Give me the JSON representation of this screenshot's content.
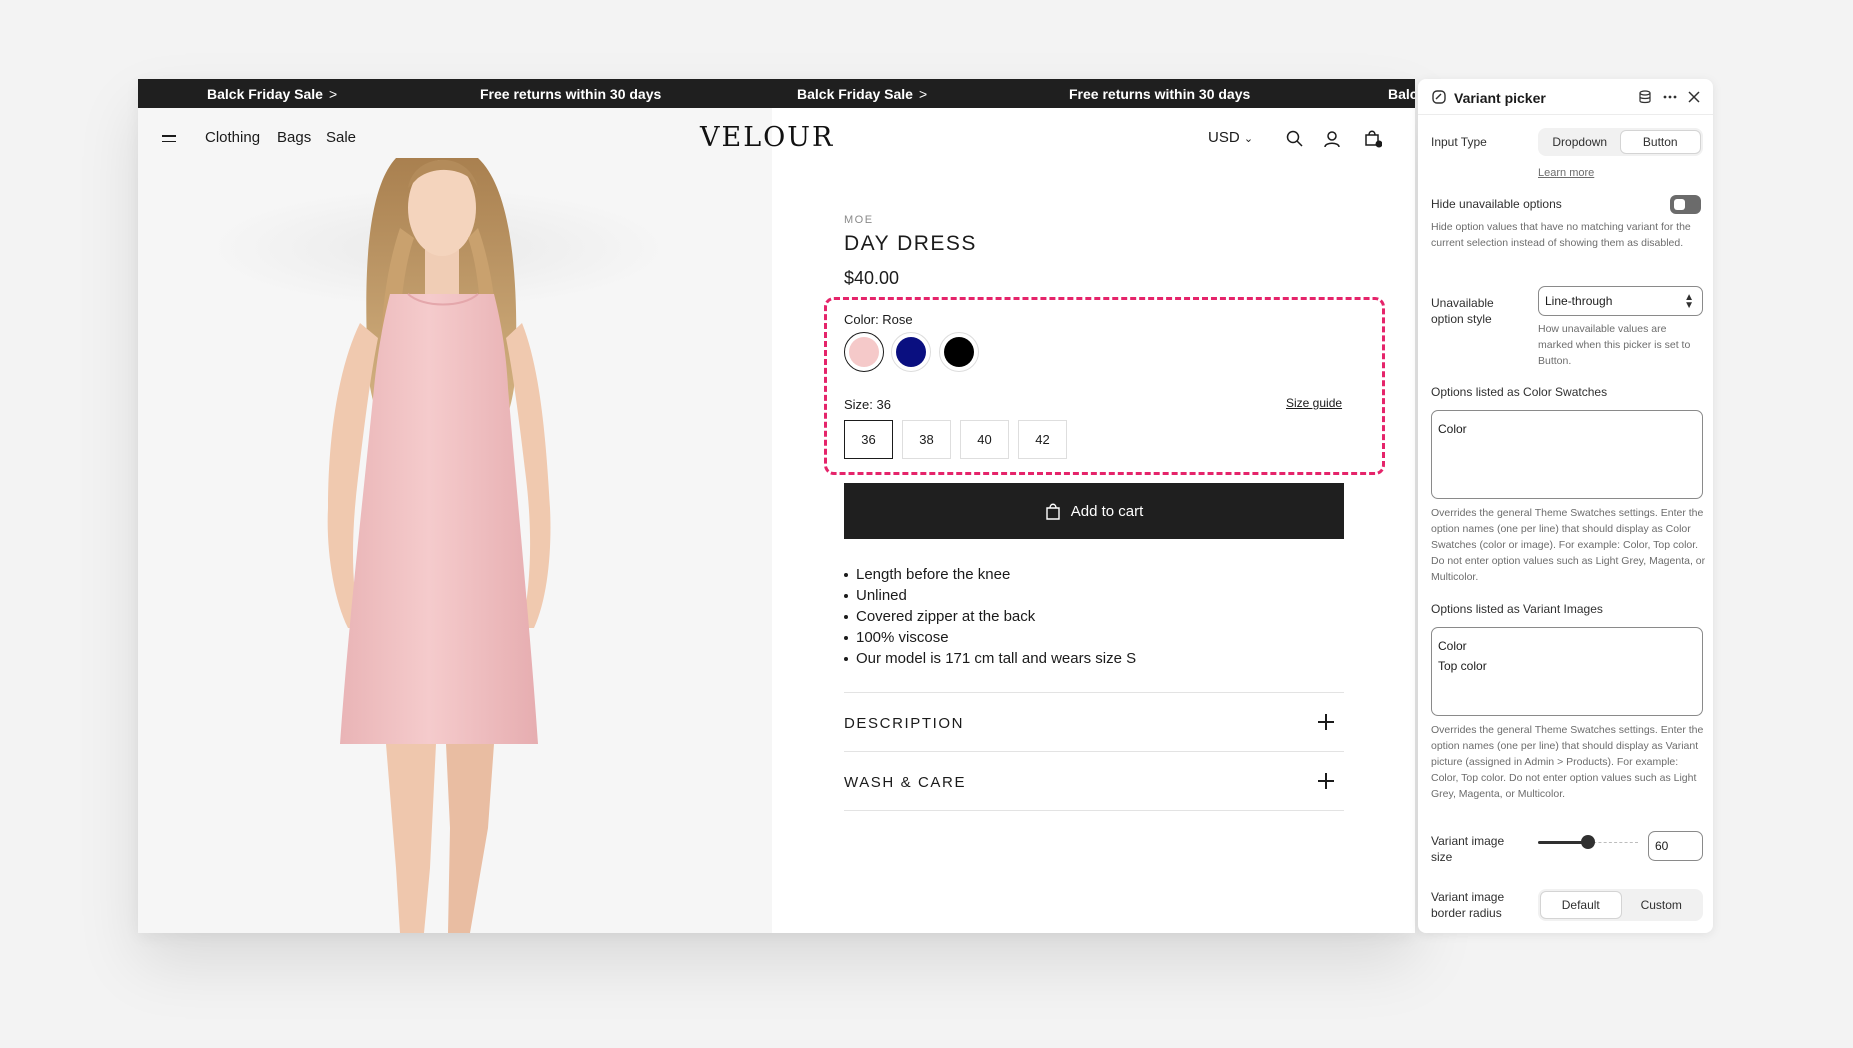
{
  "announcement": {
    "messages": [
      {
        "text": "Balck Friday Sale",
        "chevron": ">"
      },
      {
        "text": "Free returns within 30 days",
        "chevron": ""
      },
      {
        "text": "Balck Friday Sale",
        "chevron": ">"
      },
      {
        "text": "Free returns within 30 days",
        "chevron": ""
      },
      {
        "text": "Balc",
        "chevron": ""
      }
    ]
  },
  "header": {
    "menu": [
      "Clothing",
      "Bags",
      "Sale"
    ],
    "logo": "VELOUR",
    "currency": "USD",
    "icons": [
      "menu-icon",
      "search-icon",
      "account-icon",
      "cart-icon"
    ]
  },
  "product": {
    "vendor": "MOE",
    "title": "DAY DRESS",
    "price": "$40.00",
    "color_label": "Color: Rose",
    "colors": [
      {
        "name": "Rose",
        "hex": "#f5c9c9",
        "selected": true
      },
      {
        "name": "Navy",
        "hex": "#0a0f80",
        "selected": false
      },
      {
        "name": "Black",
        "hex": "#000000",
        "selected": false
      }
    ],
    "size_label": "Size: 36",
    "size_guide": "Size guide",
    "sizes": [
      {
        "label": "36",
        "selected": true
      },
      {
        "label": "38",
        "selected": false
      },
      {
        "label": "40",
        "selected": false
      },
      {
        "label": "42",
        "selected": false
      }
    ],
    "add_to_cart": "Add to cart",
    "bullets": [
      "Length before the knee",
      "Unlined",
      "Covered zipper at the back",
      "100% viscose",
      "Our model is 171 cm tall and wears size S"
    ],
    "accordions": [
      "DESCRIPTION",
      "WASH & CARE"
    ]
  },
  "panel": {
    "title": "Variant picker",
    "input_type_label": "Input Type",
    "input_type_options": [
      "Dropdown",
      "Button"
    ],
    "input_type_selected": "Button",
    "learn_more": "Learn more",
    "hide_unavailable_label": "Hide unavailable options",
    "hide_unavailable_on": false,
    "hide_unavailable_help": "Hide option values that have no matching variant for the current selection instead of showing them as disabled.",
    "unavailable_style_label": "Unavailable option style",
    "unavailable_style_value": "Line-through",
    "unavailable_style_help": "How unavailable values are marked when this picker is set to Button.",
    "color_swatches_label": "Options listed as Color Swatches",
    "color_swatches_value": "Color",
    "color_swatches_help": "Overrides the general Theme Swatches settings. Enter the option names (one per line) that should display as Color Swatches (color or image). For example: Color, Top color. Do not enter option values such as Light Grey, Magenta, or Multicolor.",
    "variant_images_label": "Options listed as Variant Images",
    "variant_images_value": "Color\nTop color",
    "variant_images_help": "Overrides the general Theme Swatches settings. Enter the option names (one per line) that should display as Variant picture (assigned in Admin > Products). For example: Color, Top color. Do not enter option values such as Light Grey, Magenta, or Multicolor.",
    "image_size_label": "Variant image size",
    "image_size_value": "60",
    "border_radius_label": "Variant image border radius",
    "border_radius_options": [
      "Default",
      "Custom"
    ],
    "border_radius_selected": "Default"
  },
  "colors": {
    "highlight": "#e5246a",
    "topbar": "#1f1f1f",
    "dress": "#f3c7c7",
    "hair": "#c9a16e"
  }
}
